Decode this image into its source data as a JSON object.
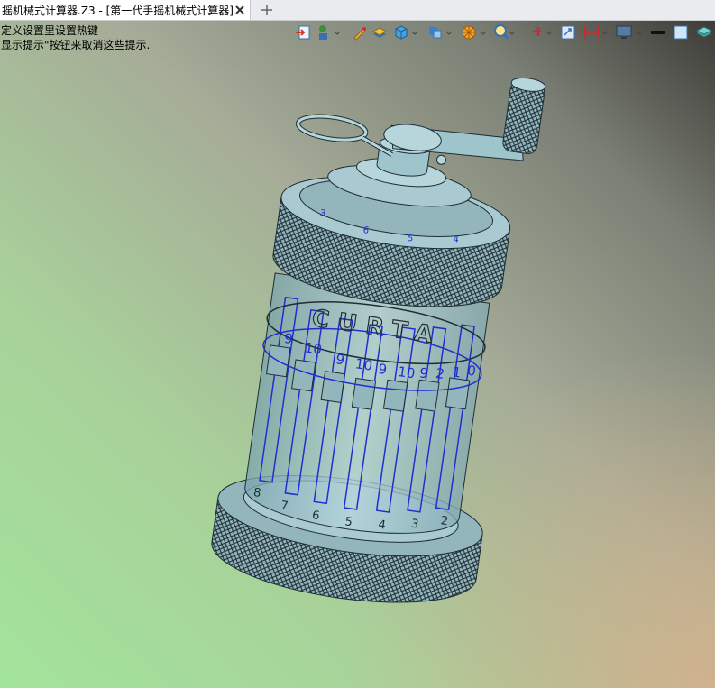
{
  "window": {
    "tab_title": "摇机械式计算器.Z3 - [第一代手摇机械式计算器]",
    "close_icon": "close-icon",
    "new_tab_icon": "plus-icon"
  },
  "hints": {
    "line1": "定义设置里设置热键",
    "line2": "显示提示\"按钮来取消这些提示."
  },
  "model": {
    "brand": "CURTA",
    "digits_bottom": [
      "8",
      "7",
      "6",
      "5",
      "4",
      "3",
      "2"
    ],
    "digits_top": [
      "3",
      "6",
      "5",
      "4"
    ],
    "counter_digits": [
      "9",
      "10",
      "9",
      "10",
      "9",
      "10",
      "9",
      "2",
      "1",
      "0"
    ]
  },
  "toolbar": {
    "icons": [
      "import-icon",
      "manager-icon",
      "pen-icon",
      "shading-icon",
      "cube-view-icon",
      "render-mode-icon",
      "filter-icon",
      "zoom-icon",
      "pin-icon",
      "view-fit-icon",
      "dimension-icon",
      "monitor-icon",
      "line-color-icon",
      "fill-color-icon",
      "layer-icon"
    ]
  },
  "colors": {
    "body": "#9ec4cc",
    "edges": "#2c3c46",
    "wire": "#1f2fd0"
  }
}
